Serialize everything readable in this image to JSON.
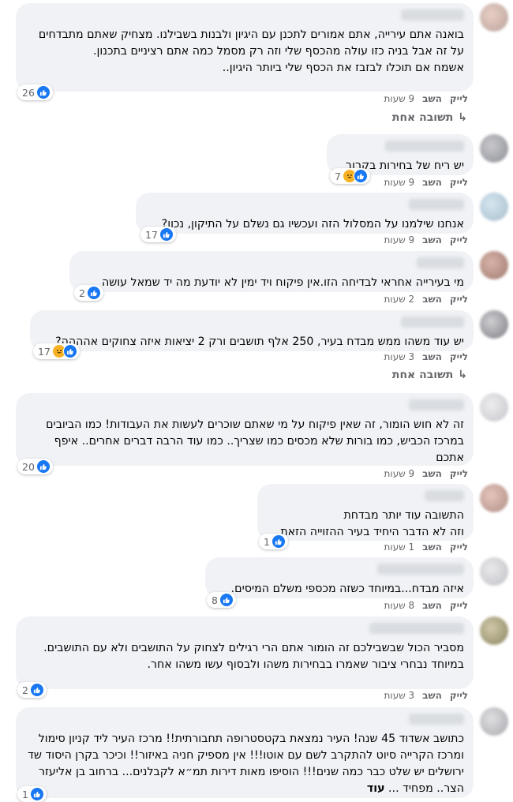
{
  "labels": {
    "like": "לייק",
    "reply": "השב"
  },
  "comments": [
    {
      "text": "בואנה אתם עירייה, אתם אמורים לתכנן עם היגיון ולבנות בשבילנו. מצחיק שאתם מתבדחים על זה אבל בניה כזו עולה מהכסף שלי וזה רק מסמל כמה אתם רציניים בתכנון.\nאשמח אם תוכלו לבזבז את הכסף שלי ביותר היגיון..",
      "reactions": "26",
      "time": "9 שעות",
      "replies": "תשובה אחת"
    },
    {
      "text": "יש ריח של בחירות בקרוב",
      "reactions": "7",
      "time": "9 שעות"
    },
    {
      "text": "אנחנו שילמנו על המסלול הזה ועכשיו גם נשלם על התיקון, נכון?",
      "reactions": "17",
      "time": "9 שעות"
    },
    {
      "text": "מי בעירייה אחראי לבדיחה הזו.אין פיקוח ויד ימין לא יודעת מה יד שמאל עושה",
      "reactions": "2",
      "time": "2 שעות"
    },
    {
      "text": "יש עוד משהו ממש מבדח בעיר, 250 אלף תושבים ורק 2 יציאות איזה צחוקים אהההה?",
      "reactions": "17",
      "time": "3 שעות",
      "replies": "תשובה אחת"
    },
    {
      "text": "זה לא חוש הומור, זה שאין פיקוח על מי שאתם שוכרים לעשות את העבודות! כמו הביובים במרכז הכביש, כמו בורות שלא מכסים כמו שצריך.. כמו עוד הרבה דברים אחרים.. איפף אתכם",
      "reactions": "20",
      "time": "9 שעות"
    },
    {
      "text": "התשובה עוד יותר מבדחת\nוזה לא הדבר היחיד בעיר ההזוייה הזאת",
      "reactions": "1",
      "time": "1 שעות"
    },
    {
      "text": "איזה מבדח...במיוחד כשזה מכספי משלם המיסים.",
      "reactions": "8",
      "time": "8 שעות"
    },
    {
      "text": "מסביר הכול שבשבילכם זה הומור אתם הרי רגילים לצחוק על התושבים ולא עם התושבים.\nבמיוחד נבחרי ציבור שאמרו בבחירות משהו ולבסוף עשו משהו אחר.",
      "reactions": "2",
      "time": "3 שעות"
    },
    {
      "text": "כתושב אשדוד 45 שנה! העיר נמצאת בקטסטרופה תחבורתית!! מרכז העיר ליד קניון סימול ומרכז הקרייה סיוט להתקרב לשם עם אוטו!!! אין מספיק חניה באיזור!! וכיכר בקרן היסוד שד ירושלים יש שלט כבר כמה שנים!!! הוסיפו מאות דירות תמ״א לקבלנים... ברחוב בן אליעזר הצר.. מפחיד ...",
      "more": "עוד",
      "reactions": "1"
    }
  ],
  "colors": {
    "like": "#1877f2",
    "haha": "#f7b125",
    "bubble": "#f0f2f5",
    "meta": "#65676b"
  }
}
